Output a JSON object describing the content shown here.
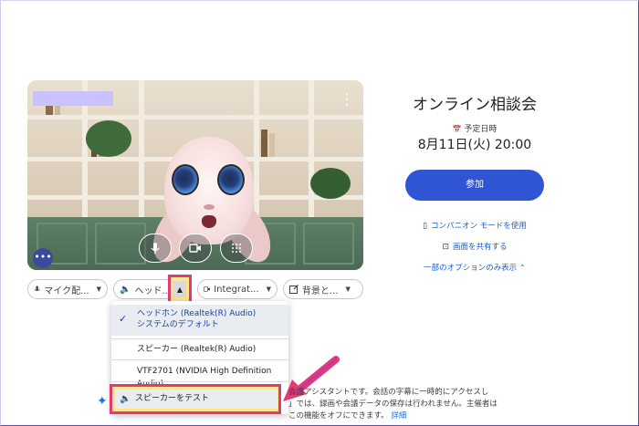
{
  "meeting": {
    "title": "オンライン相談会",
    "schedule_label": "予定日時",
    "schedule_value": "8月11日(火)  20:00",
    "join_label": "参加",
    "companion_label": "コンパニオン モードを使用",
    "share_label": "画面を共有する",
    "options_label": "一部のオプションのみ表示"
  },
  "preview": {
    "more_label": "⋮",
    "effects_label": "•••"
  },
  "devices": {
    "mic_label": "マイク配...",
    "speaker_label": "ヘッド...",
    "camera_label": "Integrat...",
    "background_label": "背景と..."
  },
  "speaker_menu": {
    "selected_name": "ヘッドホン (Realtek(R) Audio)",
    "selected_sub": "システムのデフォルト",
    "option_2": "スピーカー (Realtek(R) Audio)",
    "option_3": "VTF2701 (NVIDIA High Definition Audio)",
    "test_label": "スピーカーをテスト"
  },
  "note": {
    "line1": "会議アシスタントです。会話の字幕に一時的にアクセスし",
    "line2": "」では、録画や会議データの保存は行われません。主催者は",
    "line3": "この機能をオフにできます。",
    "details_link": "詳細"
  },
  "colors": {
    "accent": "#2f55d4",
    "highlight_border": "#e53974",
    "highlight_fill": "#fde68a",
    "link": "#1a5fd1"
  },
  "icons": {
    "mic": "mic-icon",
    "camera": "camera-icon",
    "effects": "sparkle-grid-icon",
    "speaker": "speaker-icon",
    "check": "check-icon",
    "caret_up": "caret-up-icon",
    "calendar": "calendar-icon",
    "companion": "companion-icon",
    "share": "share-screen-icon"
  }
}
